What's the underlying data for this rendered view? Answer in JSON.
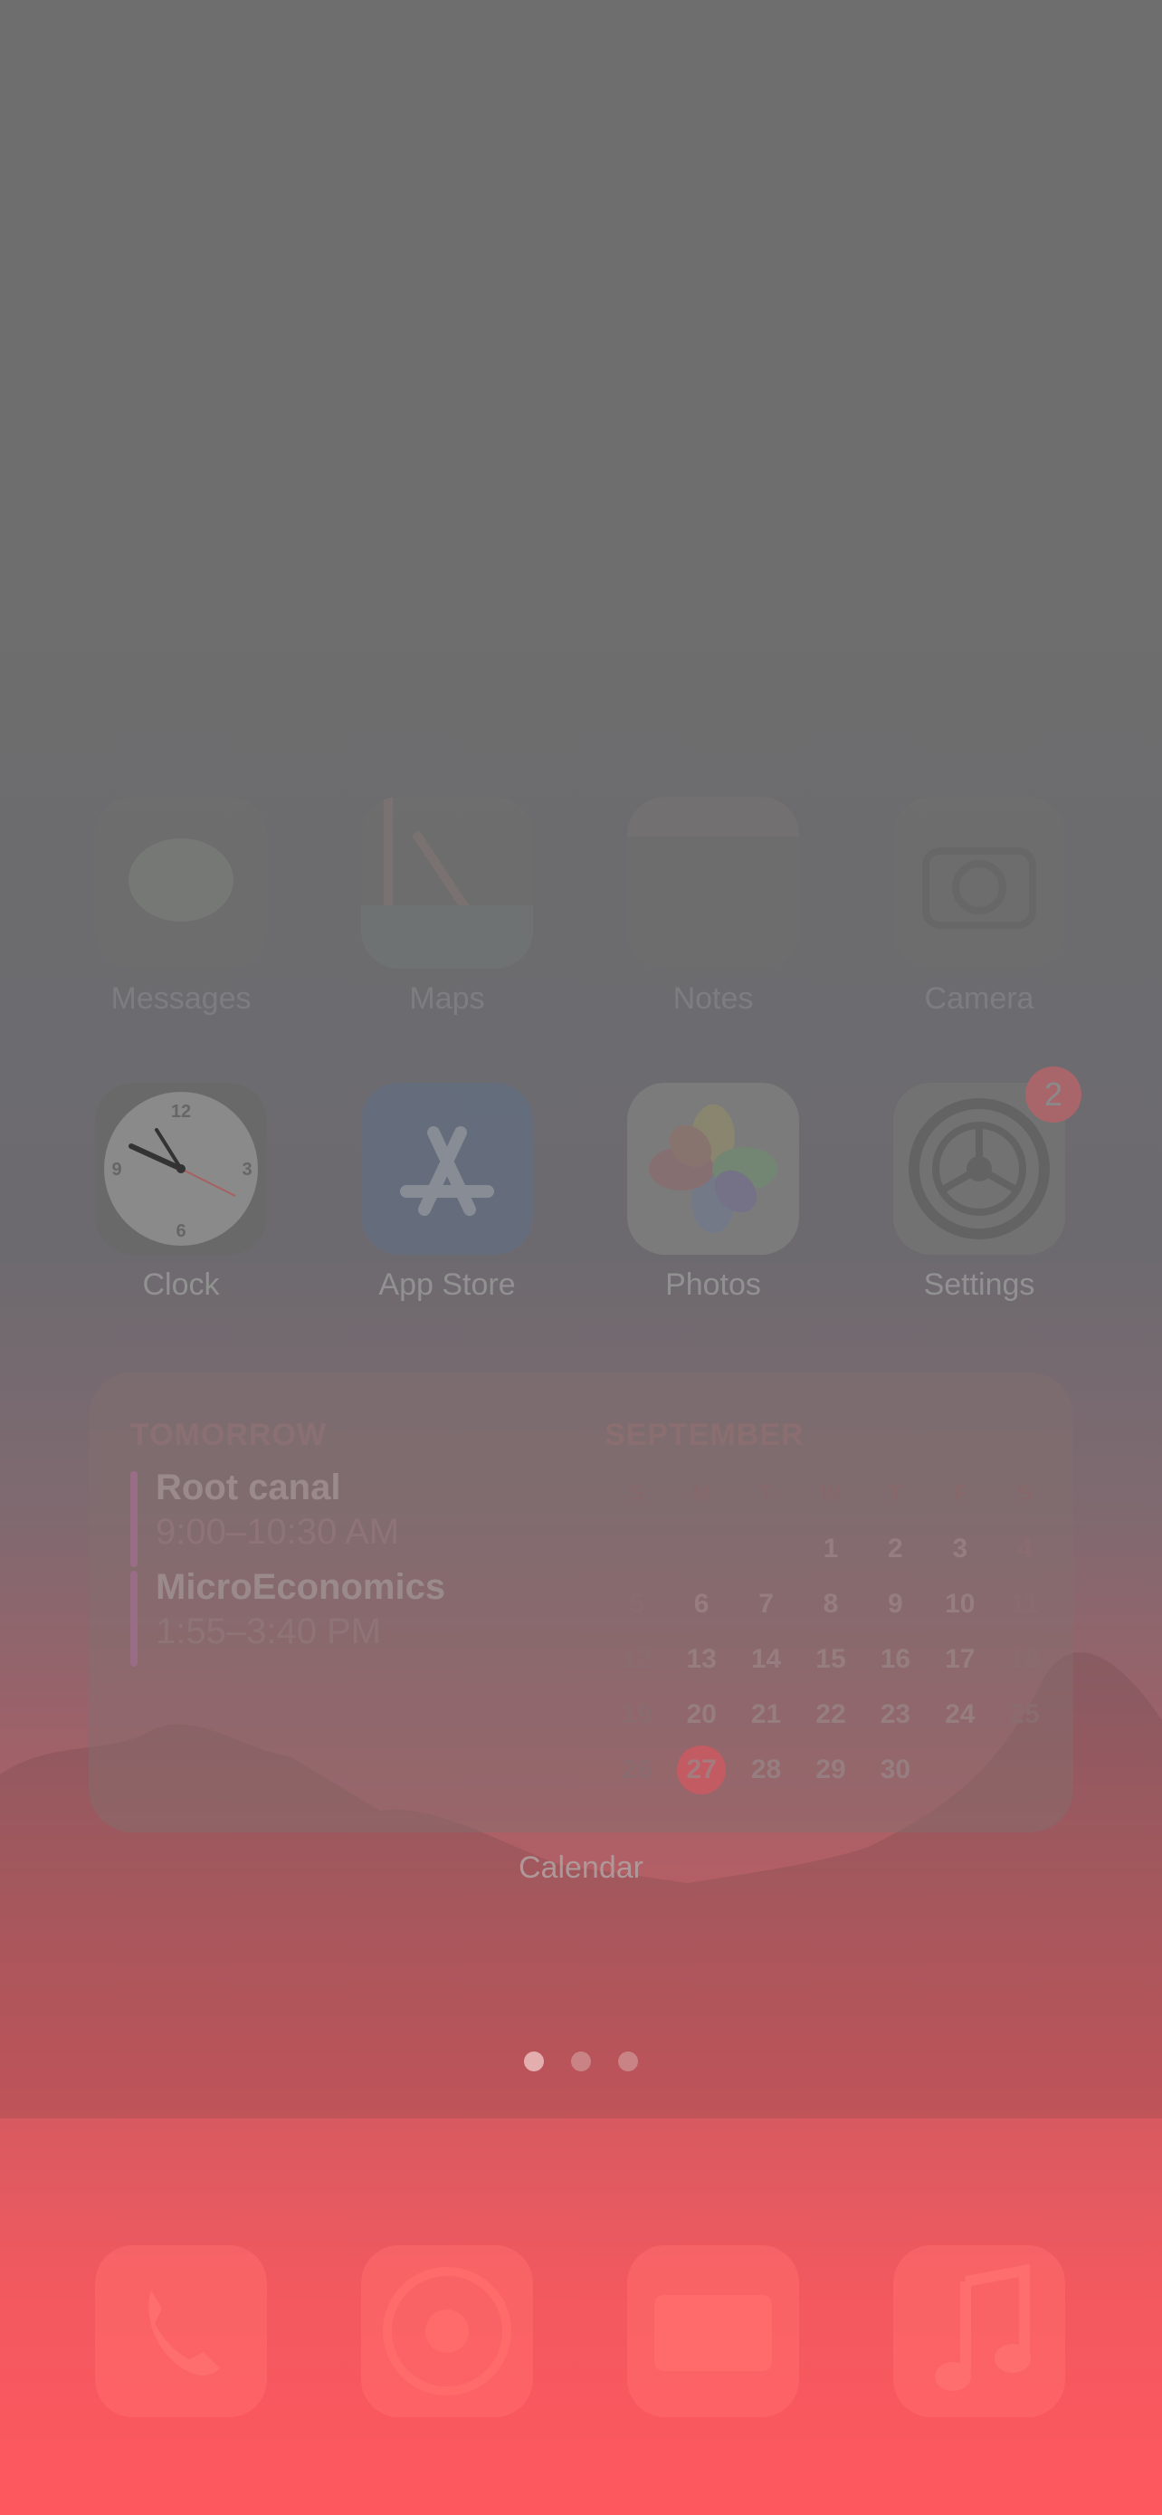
{
  "apps_row1": [
    {
      "name": "Messages",
      "icon": "messages-icon"
    },
    {
      "name": "Maps",
      "icon": "maps-icon"
    },
    {
      "name": "Notes",
      "icon": "notes-icon"
    },
    {
      "name": "Camera",
      "icon": "camera-icon"
    }
  ],
  "apps_row2": [
    {
      "name": "Clock",
      "icon": "clock-icon"
    },
    {
      "name": "App Store",
      "icon": "app-store-icon"
    },
    {
      "name": "Photos",
      "icon": "photos-icon"
    },
    {
      "name": "Settings",
      "icon": "settings-icon",
      "badge": "2"
    }
  ],
  "calendar_widget": {
    "header": "TOMORROW",
    "events": [
      {
        "title": "Root canal",
        "time": "9:00–10:30 AM"
      },
      {
        "title": "MicroEconomics",
        "time": "1:55–3:40 PM"
      }
    ],
    "month": "SEPTEMBER",
    "weekdays": [
      "S",
      "M",
      "T",
      "W",
      "T",
      "F",
      "S"
    ],
    "weeks": [
      [
        "",
        "",
        "",
        "1",
        "2",
        "3",
        "4"
      ],
      [
        "5",
        "6",
        "7",
        "8",
        "9",
        "10",
        "11"
      ],
      [
        "12",
        "13",
        "14",
        "15",
        "16",
        "17",
        "18"
      ],
      [
        "19",
        "20",
        "21",
        "22",
        "23",
        "24",
        "25"
      ],
      [
        "26",
        "27",
        "28",
        "29",
        "30",
        "",
        ""
      ]
    ],
    "today": "27",
    "label": "Calendar"
  },
  "page_dots": {
    "count": 3,
    "active": 0
  },
  "dock": [
    {
      "icon": "phone-icon"
    },
    {
      "icon": "safari-icon"
    },
    {
      "icon": "mail-icon"
    },
    {
      "icon": "music-icon"
    }
  ]
}
